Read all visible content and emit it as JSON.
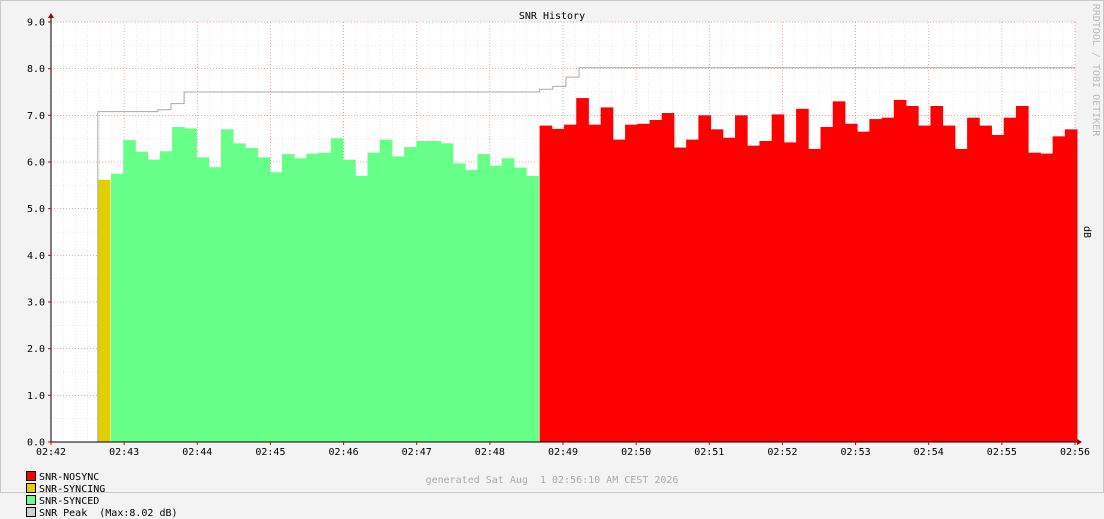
{
  "colors": {
    "nosync": "#ff0000",
    "syncing": "#e0d000",
    "synced": "#66ff88",
    "peak": "#aaaaaa"
  },
  "legend": [
    {
      "label": "SNR-NOSYNC",
      "color": "#ff0000"
    },
    {
      "label": "SNR-SYNCING",
      "color": "#e0d000"
    },
    {
      "label": "SNR-SYNCED",
      "color": "#66ff88"
    },
    {
      "label": "SNR Peak",
      "color": "#d0d0d0"
    }
  ],
  "legend_extra": "(Max:8.02 dB)",
  "footer": "generated Sat Aug  1 02:56:10 AM CEST 2026",
  "side_label": "RRDTOOL / TOBI OETIKER",
  "chart_data": {
    "type": "area",
    "title": "SNR History",
    "ylabel": "dB",
    "xlabel": "",
    "x_unit": "minutes after 02:42",
    "x_ticks": [
      "02:42",
      "02:43",
      "02:44",
      "02:45",
      "02:46",
      "02:47",
      "02:48",
      "02:49",
      "02:50",
      "02:51",
      "02:52",
      "02:53",
      "02:54",
      "02:55",
      "02:56"
    ],
    "y_ticks": [
      "0.0",
      "1.0",
      "2.0",
      "3.0",
      "4.0",
      "5.0",
      "6.0",
      "7.0",
      "8.0",
      "9.0"
    ],
    "xlim": [
      0,
      14
    ],
    "ylim": [
      0,
      9
    ],
    "grid": true,
    "series": [
      {
        "name": "SNR-SYNCING",
        "x_start": 0.64,
        "step": 0.167,
        "values": [
          5.62
        ]
      },
      {
        "name": "SNR-SYNCED",
        "x_start": 0.82,
        "step": 0.167,
        "values": [
          5.75,
          6.47,
          6.22,
          6.05,
          6.23,
          6.75,
          6.72,
          6.1,
          5.89,
          6.7,
          6.4,
          6.3,
          6.1,
          5.78,
          6.17,
          6.08,
          6.18,
          6.2,
          6.51,
          6.05,
          5.7,
          6.2,
          6.48,
          6.12,
          6.32,
          6.45,
          6.45,
          6.4,
          5.97,
          5.83,
          6.17,
          5.92,
          6.08,
          5.88,
          5.7
        ]
      },
      {
        "name": "SNR-NOSYNC",
        "x_start": 6.68,
        "step": 0.167,
        "values": [
          6.78,
          6.71,
          6.8,
          7.37,
          6.8,
          7.17,
          6.48,
          6.8,
          6.82,
          6.9,
          7.05,
          6.31,
          6.48,
          7.0,
          6.7,
          6.52,
          7.0,
          6.35,
          6.45,
          7.02,
          6.42,
          7.14,
          6.28,
          6.75,
          7.3,
          6.82,
          6.65,
          6.92,
          6.95,
          7.33,
          7.2,
          6.78,
          7.2,
          6.78,
          6.28,
          6.95,
          6.78,
          6.58,
          6.95,
          7.2,
          6.2,
          6.18,
          6.55,
          6.7
        ]
      },
      {
        "name": "SNR Peak",
        "steps": [
          [
            0.64,
            7.08
          ],
          [
            1.46,
            7.12
          ],
          [
            1.64,
            7.25
          ],
          [
            1.82,
            7.5
          ],
          [
            6.68,
            7.56
          ],
          [
            6.86,
            7.62
          ],
          [
            7.04,
            7.82
          ],
          [
            7.22,
            8.02
          ],
          [
            14,
            8.02
          ]
        ]
      }
    ]
  }
}
